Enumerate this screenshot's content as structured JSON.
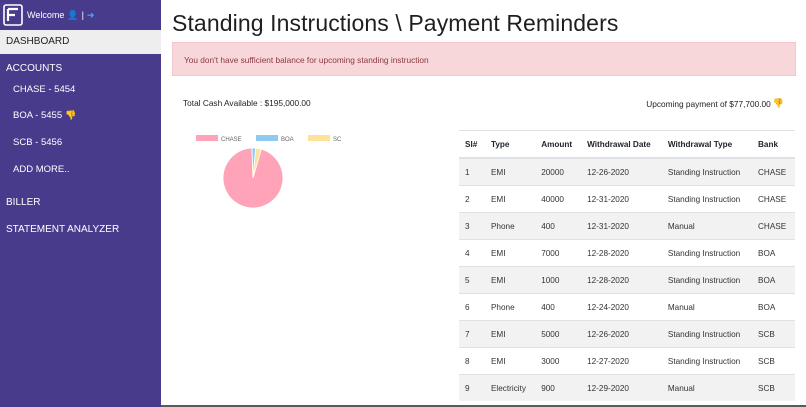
{
  "sidebar": {
    "welcome": "Welcome",
    "separator": "|",
    "dashboard": "DASHBOARD",
    "accounts": "ACCOUNTS",
    "sub_items": [
      "CHASE - 5454",
      "BOA - 5455",
      "SCB - 5456",
      "ADD MORE.."
    ],
    "biller": "BILLER",
    "statement_analyzer": "STATEMENT ANALYZER"
  },
  "page_title": "Standing Instructions \\ Payment Reminders",
  "alert": "You don't have sufficient balance for upcoming standing instruction",
  "total_cash": "Total Cash Available : $195,000.00",
  "upcoming_payment": "Upcoming payment of $77,700.00",
  "chart_data": {
    "type": "pie",
    "legend": [
      "CHASE",
      "BOA",
      "SCB"
    ],
    "colors": [
      "#ffa3b8",
      "#8ec9f0",
      "#fde29a"
    ],
    "values": [
      95,
      2,
      3
    ],
    "legend_position": "top"
  },
  "table": {
    "headers": [
      "Sl#",
      "Type",
      "Amount",
      "Withdrawal Date",
      "Withdrawal Type",
      "Bank"
    ],
    "rows": [
      [
        "1",
        "EMI",
        "20000",
        "12-26-2020",
        "Standing Instruction",
        "CHASE"
      ],
      [
        "2",
        "EMI",
        "40000",
        "12-31-2020",
        "Standing Instruction",
        "CHASE"
      ],
      [
        "3",
        "Phone",
        "400",
        "12-31-2020",
        "Manual",
        "CHASE"
      ],
      [
        "4",
        "EMI",
        "7000",
        "12-28-2020",
        "Standing Instruction",
        "BOA"
      ],
      [
        "5",
        "EMI",
        "1000",
        "12-28-2020",
        "Standing Instruction",
        "BOA"
      ],
      [
        "6",
        "Phone",
        "400",
        "12-24-2020",
        "Manual",
        "BOA"
      ],
      [
        "7",
        "EMI",
        "5000",
        "12-26-2020",
        "Standing Instruction",
        "SCB"
      ],
      [
        "8",
        "EMI",
        "3000",
        "12-27-2020",
        "Standing Instruction",
        "SCB"
      ],
      [
        "9",
        "Electricity",
        "900",
        "12-29-2020",
        "Manual",
        "SCB"
      ]
    ]
  },
  "icons": {
    "logo": "app-logo-icon",
    "user": "user-icon",
    "logout": "logout-icon",
    "thumbs_down": "thumbs-down-icon"
  }
}
